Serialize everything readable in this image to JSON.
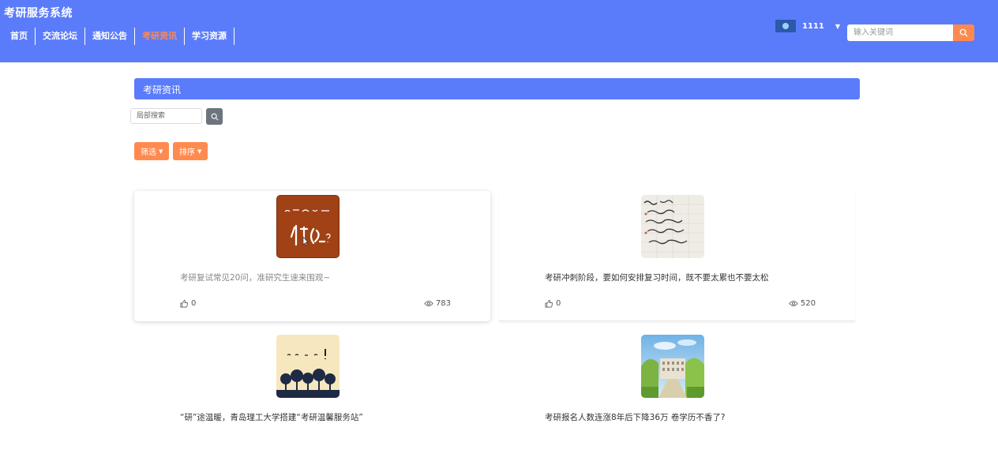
{
  "header": {
    "site_title": "考研服务系统",
    "nav": [
      {
        "label": "首页"
      },
      {
        "label": "交流论坛"
      },
      {
        "label": "通知公告"
      },
      {
        "label": "考研资讯"
      },
      {
        "label": "学习资源"
      }
    ],
    "active_nav": "考研资讯",
    "username": "1111",
    "search_placeholder": "输入关键词"
  },
  "main": {
    "section_title": "考研资讯",
    "local_search_placeholder": "局部搜索",
    "filter_label": "筛选",
    "sort_label": "排序",
    "articles": [
      {
        "title": "考研复试常见20问，准研究生速来围观~",
        "likes": "0",
        "views": "783",
        "image": "red-handwriting-thumbnail"
      },
      {
        "title": "考研冲刺阶段，要如何安排复习时间，既不要太累也不要太松",
        "likes": "0",
        "views": "520",
        "image": "notepad-handwriting-thumbnail"
      },
      {
        "title": "“研”途温暖，青岛理工大学搭建“考研温馨服务站”",
        "likes": "",
        "views": "",
        "image": "trees-silhouette-thumbnail"
      },
      {
        "title": "考研报名人数连涨8年后下降36万 卷学历不香了?",
        "likes": "",
        "views": "",
        "image": "campus-building-thumbnail"
      }
    ]
  },
  "colors": {
    "header_bg": "#5b7cfa",
    "accent": "#ff8a50",
    "search_btn_dark": "#6c757d"
  }
}
